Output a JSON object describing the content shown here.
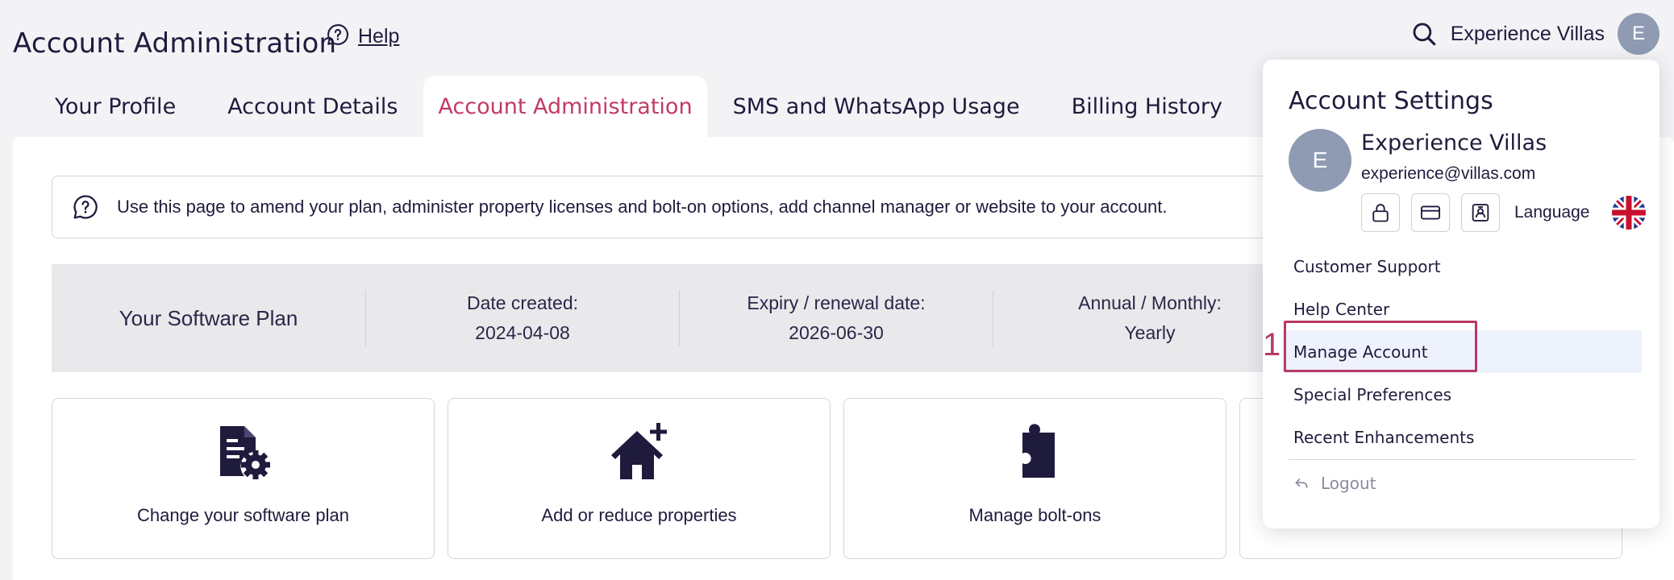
{
  "header": {
    "title": "Account Administration",
    "help_label": "Help",
    "user_name": "Experience Villas",
    "avatar_initial": "E"
  },
  "tabs": [
    {
      "label": "Your Profile",
      "active": false
    },
    {
      "label": "Account Details",
      "active": false
    },
    {
      "label": "Account Administration",
      "active": true
    },
    {
      "label": "SMS and WhatsApp Usage",
      "active": false
    },
    {
      "label": "Billing History",
      "active": false
    }
  ],
  "info": {
    "message": "Use this page to amend your plan, administer property licenses and bolt-on options, add channel manager or website to your account."
  },
  "plan": {
    "title": "Your Software Plan",
    "date_created_label": "Date created:",
    "date_created": "2024-04-08",
    "expiry_label": "Expiry / renewal date:",
    "expiry": "2026-06-30",
    "billing_label": "Annual / Monthly:",
    "billing": "Yearly"
  },
  "cards": [
    {
      "label": "Change your software plan",
      "icon": "document-gear-icon"
    },
    {
      "label": "Add or reduce properties",
      "icon": "house-plus-icon"
    },
    {
      "label": "Manage bolt-ons",
      "icon": "puzzle-icon"
    }
  ],
  "dropdown": {
    "title": "Account Settings",
    "avatar_initial": "E",
    "name": "Experience Villas",
    "email": "experience@villas.com",
    "language_label": "Language",
    "items": [
      {
        "label": "Customer Support"
      },
      {
        "label": "Help Center"
      },
      {
        "label": "Manage Account"
      },
      {
        "label": "Special Preferences"
      },
      {
        "label": "Recent Enhancements"
      }
    ],
    "logout_label": "Logout"
  },
  "annotation": {
    "number": "1",
    "color": "#b83a66"
  },
  "colors": {
    "accent": "#c23b63",
    "navy": "#1f1b3d",
    "background": "#f3f3f6"
  }
}
